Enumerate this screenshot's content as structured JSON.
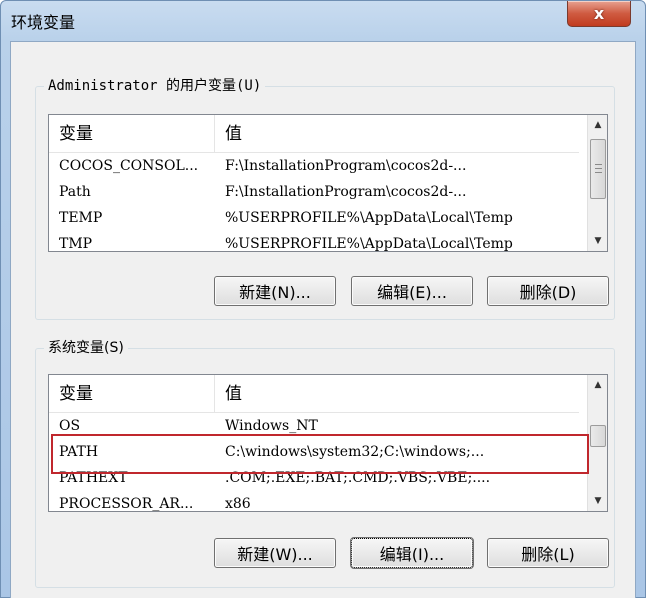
{
  "window": {
    "title": "环境变量",
    "close_label": "x"
  },
  "user_vars": {
    "group_label": "Administrator 的用户变量(U)",
    "columns": [
      "变量",
      "值"
    ],
    "rows": [
      {
        "name": "COCOS_CONSOL...",
        "value": "F:\\InstallationProgram\\cocos2d-..."
      },
      {
        "name": "Path",
        "value": "F:\\InstallationProgram\\cocos2d-..."
      },
      {
        "name": "TEMP",
        "value": "%USERPROFILE%\\AppData\\Local\\Temp"
      },
      {
        "name": "TMP",
        "value": "%USERPROFILE%\\AppData\\Local\\Temp"
      }
    ],
    "buttons": {
      "new": "新建(N)...",
      "edit": "编辑(E)...",
      "delete": "删除(D)"
    }
  },
  "system_vars": {
    "group_label": "系统变量(S)",
    "columns": [
      "变量",
      "值"
    ],
    "rows": [
      {
        "name": "OS",
        "value": "Windows_NT"
      },
      {
        "name": "PATH",
        "value": "C:\\windows\\system32;C:\\windows;..."
      },
      {
        "name": "PATHEXT",
        "value": ".COM;.EXE;.BAT;.CMD;.VBS;.VBE;...."
      },
      {
        "name": "PROCESSOR_AR...",
        "value": "x86"
      }
    ],
    "buttons": {
      "new": "新建(W)...",
      "edit": "编辑(I)...",
      "delete": "删除(L)"
    }
  },
  "colors": {
    "highlight": "#c0272d",
    "close_button": "#cf5b41"
  }
}
